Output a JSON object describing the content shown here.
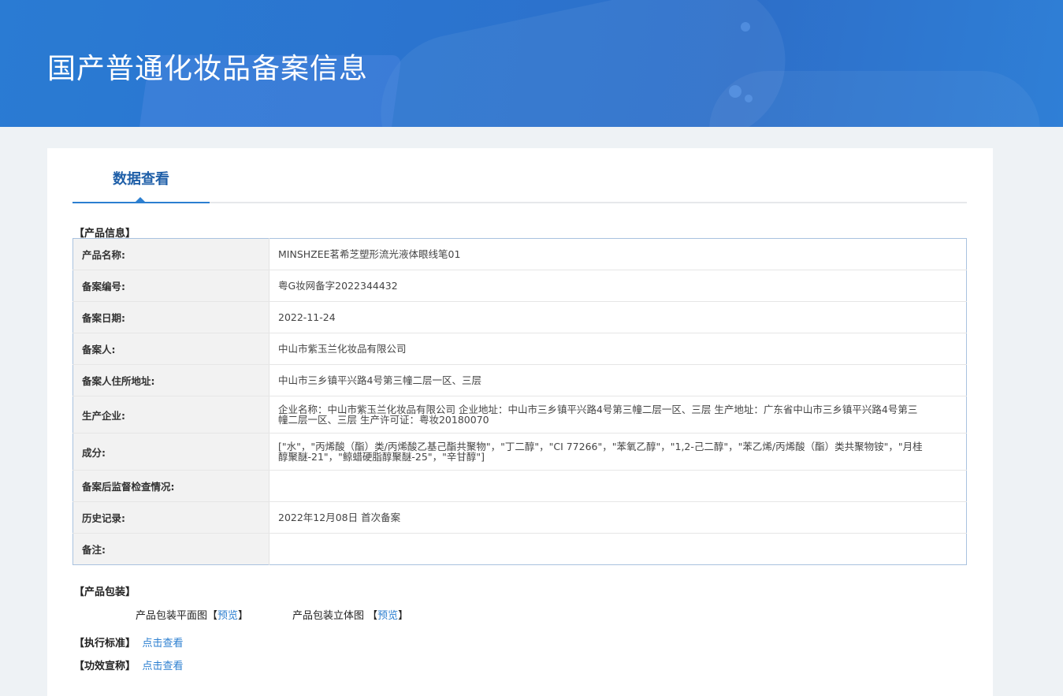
{
  "page": {
    "title": "国产普通化妆品备案信息"
  },
  "tabs": [
    {
      "label": "数据查看"
    }
  ],
  "product_info": {
    "section_label": "【产品信息】",
    "rows": [
      {
        "key": "产品名称:",
        "value": "MINSHZEE茗希芝塑形流光液体眼线笔01"
      },
      {
        "key": "备案编号:",
        "value": "粤G妆网备字2022344432"
      },
      {
        "key": "备案日期:",
        "value": "2022-11-24"
      },
      {
        "key": "备案人:",
        "value": "中山市紫玉兰化妆品有限公司"
      },
      {
        "key": "备案人住所地址:",
        "value": "中山市三乡镇平兴路4号第三幢二层一区、三层"
      },
      {
        "key": "生产企业:",
        "value": "企业名称：中山市紫玉兰化妆品有限公司 企业地址：中山市三乡镇平兴路4号第三幢二层一区、三层 生产地址：广东省中山市三乡镇平兴路4号第三幢二层一区、三层 生产许可证：粤妆20180070"
      },
      {
        "key": "成分:",
        "value": "[\"水\"，\"丙烯酸（酯）类/丙烯酸乙基己酯共聚物\"，\"丁二醇\"，\"CI 77266\"，\"苯氧乙醇\"，\"1,2-己二醇\"，\"苯乙烯/丙烯酸（酯）类共聚物铵\"，\"月桂醇聚醚-21\"，\"鲸蜡硬脂醇聚醚-25\"，\"辛甘醇\"]"
      },
      {
        "key": "备案后监督检查情况:",
        "value": ""
      },
      {
        "key": "历史记录:",
        "value": "2022年12月08日 首次备案"
      },
      {
        "key": "备注:",
        "value": ""
      }
    ]
  },
  "packaging": {
    "section_label": "【产品包装】",
    "flat_label": "产品包装平面图",
    "flat_bracket_open": "【",
    "flat_link": "预览",
    "flat_bracket_close": "】",
    "solid_label": "产品包装立体图 ",
    "solid_bracket_open": "【",
    "solid_link": "预览",
    "solid_bracket_close": "】"
  },
  "standard": {
    "label": "【执行标准】",
    "link": "点击查看"
  },
  "efficacy": {
    "label": "【功效宣称】",
    "link": "点击查看"
  },
  "colors": {
    "banner": "#2b74cf",
    "accent": "#2c7fd0",
    "tab_text": "#1f5fa8",
    "table_border": "#a9c2df",
    "key_bg": "#f2f2f2"
  }
}
